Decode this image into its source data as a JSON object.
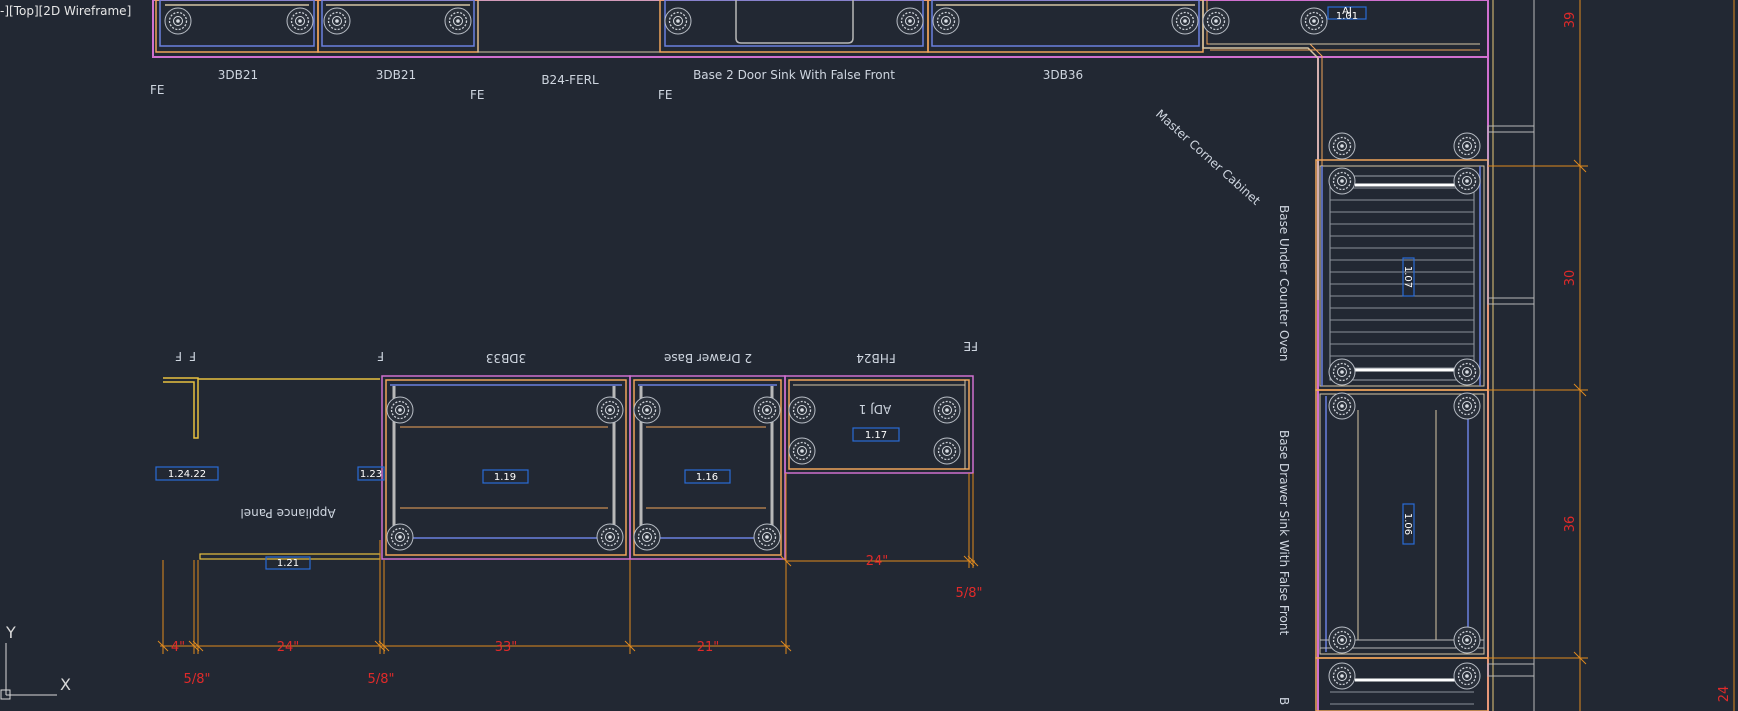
{
  "viewport_label": "-][Top][2D Wireframe]",
  "top_run": {
    "labels": [
      "3DB21",
      "3DB21",
      "B24-FERL",
      "Base 2 Door Sink With False Front",
      "3DB36"
    ],
    "fe_marks": [
      "FE",
      "FE",
      "FE"
    ],
    "tags": [
      "AJ",
      "1.01"
    ]
  },
  "corner_label": "Master Corner Cabinet",
  "right_run": {
    "labels": [
      "Base Under Counter Oven",
      "Base Drawer Sink With False Front",
      "B"
    ],
    "tags": [
      "1.07",
      "1.06"
    ],
    "dims": [
      "39",
      "30",
      "36",
      "24"
    ]
  },
  "island": {
    "labels": [
      "3DB33",
      "2 Drawer Base",
      "FHB24",
      "Appliance Panel",
      "ADJ 1"
    ],
    "marks": [
      "F",
      "F",
      "F",
      "FE"
    ],
    "tags": [
      "1.24.22",
      "1.23",
      "1.19",
      "1.16",
      "1.17",
      "1.21"
    ],
    "dims": [
      "4\"",
      "24\"",
      "33\"",
      "21\"",
      "24\"",
      "5/8\"",
      "5/8\"",
      "5/8\""
    ]
  },
  "ucs": {
    "y": "Y",
    "x": "X"
  },
  "colors": {
    "background": "#222833",
    "cabinet_outline": "#f0a45a",
    "carcass": "#d6c6a4",
    "magenta": "#d070d0",
    "blue": "#6a80e0",
    "dimension": "#e08a1e",
    "dimension_text": "#e02a2a",
    "tag_box": "#2a6cd6"
  }
}
